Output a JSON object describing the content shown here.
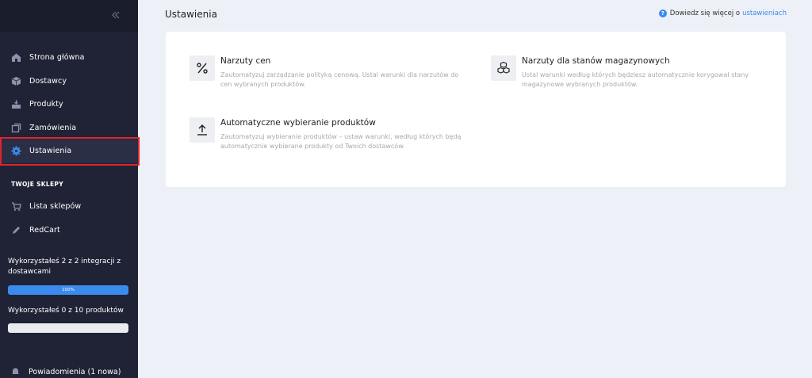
{
  "sidebar": {
    "nav": [
      {
        "label": "Strona główna",
        "icon": "home-icon"
      },
      {
        "label": "Dostawcy",
        "icon": "box-icon"
      },
      {
        "label": "Produkty",
        "icon": "products-icon"
      },
      {
        "label": "Zamówienia",
        "icon": "orders-icon"
      },
      {
        "label": "Ustawienia",
        "icon": "gear-icon"
      }
    ],
    "section_title": "TWOJE SKLEPY",
    "shops": [
      {
        "label": "Lista sklepów",
        "icon": "cart-icon"
      },
      {
        "label": "RedCart",
        "icon": "pencil-icon"
      }
    ],
    "integrations_text": "Wykorzystałeś 2 z 2 integracji z dostawcami",
    "integrations_progress": 1.0,
    "integrations_progress_label": "100%",
    "products_text": "Wykorzystałeś 0 z 10 produktów",
    "products_progress": 0.0,
    "notifications_label": "Powiadomienia (1 nowa)"
  },
  "header": {
    "title": "Ustawienia",
    "help_text": "Dowiedz się więcej o",
    "help_link": "ustawieniach"
  },
  "settings": [
    {
      "title": "Narzuty cen",
      "description": "Zautomatyzuj zarządzanie polityką cenową. Ustal warunki dla narzutów do cen wybranych produktów.",
      "icon": "percent-icon"
    },
    {
      "title": "Narzuty dla stanów magazynowych",
      "description": "Ustal warunki według których będziesz automatycznie korygował stany magazynowe wybranych produktów.",
      "icon": "boxes-icon"
    },
    {
      "title": "Automatyczne wybieranie produktów",
      "description": "Zautomatyzuj wybieranie produktów – ustaw warunki, według których będą automatycznie wybierane produkty od Twoich dostawców.",
      "icon": "upload-icon"
    }
  ],
  "colors": {
    "accent": "#3b8bee",
    "sidebar_bg": "#1f2335",
    "highlight": "#e0252b"
  }
}
